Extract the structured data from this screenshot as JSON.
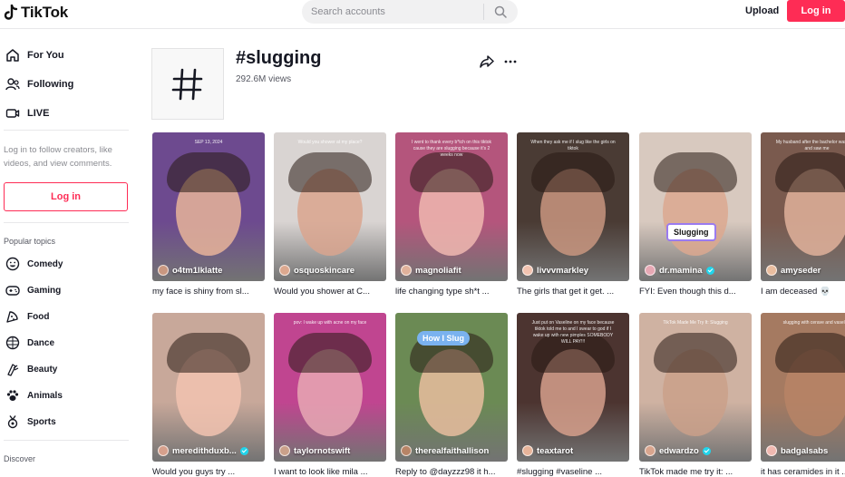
{
  "header": {
    "logo_text": "TikTok",
    "search_placeholder": "Search accounts",
    "upload_label": "Upload",
    "login_label": "Log in"
  },
  "sidebar": {
    "nav": [
      {
        "label": "For You",
        "icon": "home-icon"
      },
      {
        "label": "Following",
        "icon": "following-icon"
      },
      {
        "label": "LIVE",
        "icon": "live-icon"
      }
    ],
    "login_note": "Log in to follow creators, like videos, and view comments.",
    "login_button": "Log in",
    "popular_topics_label": "Popular topics",
    "topics": [
      {
        "label": "Comedy",
        "icon": "comedy-icon"
      },
      {
        "label": "Gaming",
        "icon": "gaming-icon"
      },
      {
        "label": "Food",
        "icon": "food-icon"
      },
      {
        "label": "Dance",
        "icon": "dance-icon"
      },
      {
        "label": "Beauty",
        "icon": "beauty-icon"
      },
      {
        "label": "Animals",
        "icon": "animals-icon"
      },
      {
        "label": "Sports",
        "icon": "sports-icon"
      }
    ],
    "discover_label": "Discover"
  },
  "hashtag": {
    "symbol": "#",
    "title": "#slugging",
    "views": "292.6M views"
  },
  "videos": [
    {
      "user": "o4tm1lklatte",
      "verified": false,
      "caption": "my face is shiny from sl...",
      "overlay": "SEP 13, 2024",
      "bg": "#6d4a8f"
    },
    {
      "user": "osquoskincare",
      "verified": false,
      "caption": "Would you shower at C...",
      "overlay": "Would you shower at my place?",
      "bg": "#d9d4d2"
    },
    {
      "user": "magnoliafit",
      "verified": false,
      "caption": "life changing type sh*t ...",
      "overlay": "I went to thank every b*tch on this tiktok cause they are slugging because it's 2 weeks now",
      "bg": "#b4557c"
    },
    {
      "user": "livvvmarkley",
      "verified": false,
      "caption": "The girls that get it get. ...",
      "overlay": "When they ask me if I slug like the girls on tiktok",
      "bg": "#4a3b34"
    },
    {
      "user": "dr.mamina",
      "verified": true,
      "caption": "FYI: Even though this d...",
      "overlay": "Slugging",
      "bg": "#d8c9bf"
    },
    {
      "user": "amyseder",
      "verified": false,
      "caption": "I am deceased 💀",
      "overlay": "My husband after the bachelor was done and saw me",
      "bg": "#7a5a4e"
    },
    {
      "user": "meredithduxb...",
      "verified": true,
      "caption": "Would you guys try ...",
      "overlay": "",
      "bg": "#c8a89a"
    },
    {
      "user": "taylornotswift",
      "verified": false,
      "caption": "I want to look like mila ...",
      "overlay": "pov: I wake up with acne on my face",
      "bg": "#c04590"
    },
    {
      "user": "therealfaithallison",
      "verified": false,
      "caption": "Reply to @dayzzz98 it h...",
      "overlay": "How I Slug",
      "bg": "#6b8a54"
    },
    {
      "user": "teaxtarot",
      "verified": false,
      "caption": "#slugging #vaseline ...",
      "overlay": "Just put on Vaseline on my face because tiktok told me to and I swear to god if I wake up with new pimples SOMEBODY WILL PAY!!!",
      "bg": "#4c3430"
    },
    {
      "user": "edwardzo",
      "verified": true,
      "caption": "TikTok made me try it: ...",
      "overlay": "TikTok Made Me Try It: Slugging",
      "bg": "#cfb2a2"
    },
    {
      "user": "badgalsabs",
      "verified": false,
      "caption": "it has ceramides in it ...",
      "overlay": "slugging with cerave and vaseline",
      "bg": "#a57a61"
    }
  ],
  "colors": {
    "accent": "#fe2c55",
    "verified": "#20d5ec",
    "text": "#161823",
    "muted": "#8a8b91"
  }
}
